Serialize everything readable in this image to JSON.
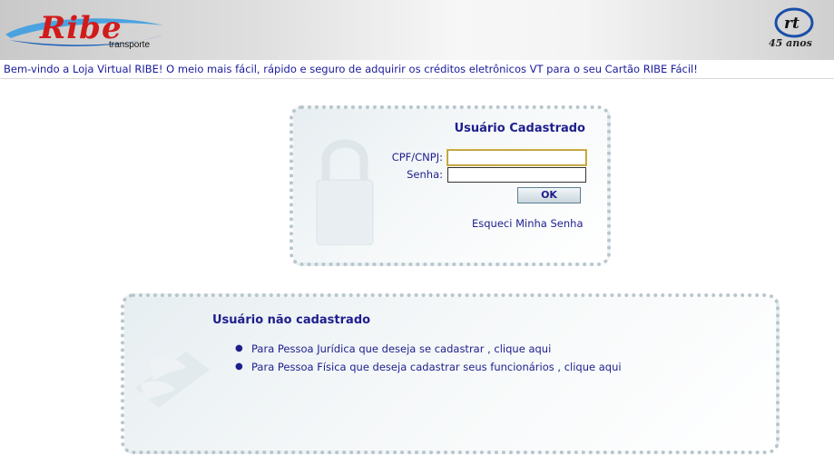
{
  "header": {
    "logo_name": "Ribe",
    "logo_sub": "transporte",
    "badge": "rt",
    "years": "45 anos"
  },
  "welcome_text": "Bem-vindo a Loja Virtual RIBE! O meio mais fácil, rápido e seguro de adquirir os créditos eletrônicos VT para o seu Cartão RIBE Fácil!",
  "login": {
    "title": "Usuário Cadastrado",
    "cpf_label": "CPF/CNPJ:",
    "cpf_value": "",
    "senha_label": "Senha:",
    "senha_value": "",
    "ok_label": "OK",
    "forgot_label": "Esqueci Minha Senha"
  },
  "not_registered": {
    "title": "Usuário não cadastrado",
    "items": [
      {
        "label": "Para Pessoa Jurídica que deseja se cadastrar , clique aqui"
      },
      {
        "label": "Para Pessoa Física que deseja cadastrar seus funcionários , clique aqui"
      }
    ]
  },
  "colors": {
    "accent": "#1e1e8c",
    "brand_red": "#d11b1b",
    "panel_border": "#b8c6cc"
  },
  "icons": {
    "logo": "ribe-swoosh-logo",
    "badge": "rt-badge-icon",
    "lock": "padlock-icon",
    "hands": "keyboard-hands-icon",
    "bullet": "bullet-icon"
  }
}
